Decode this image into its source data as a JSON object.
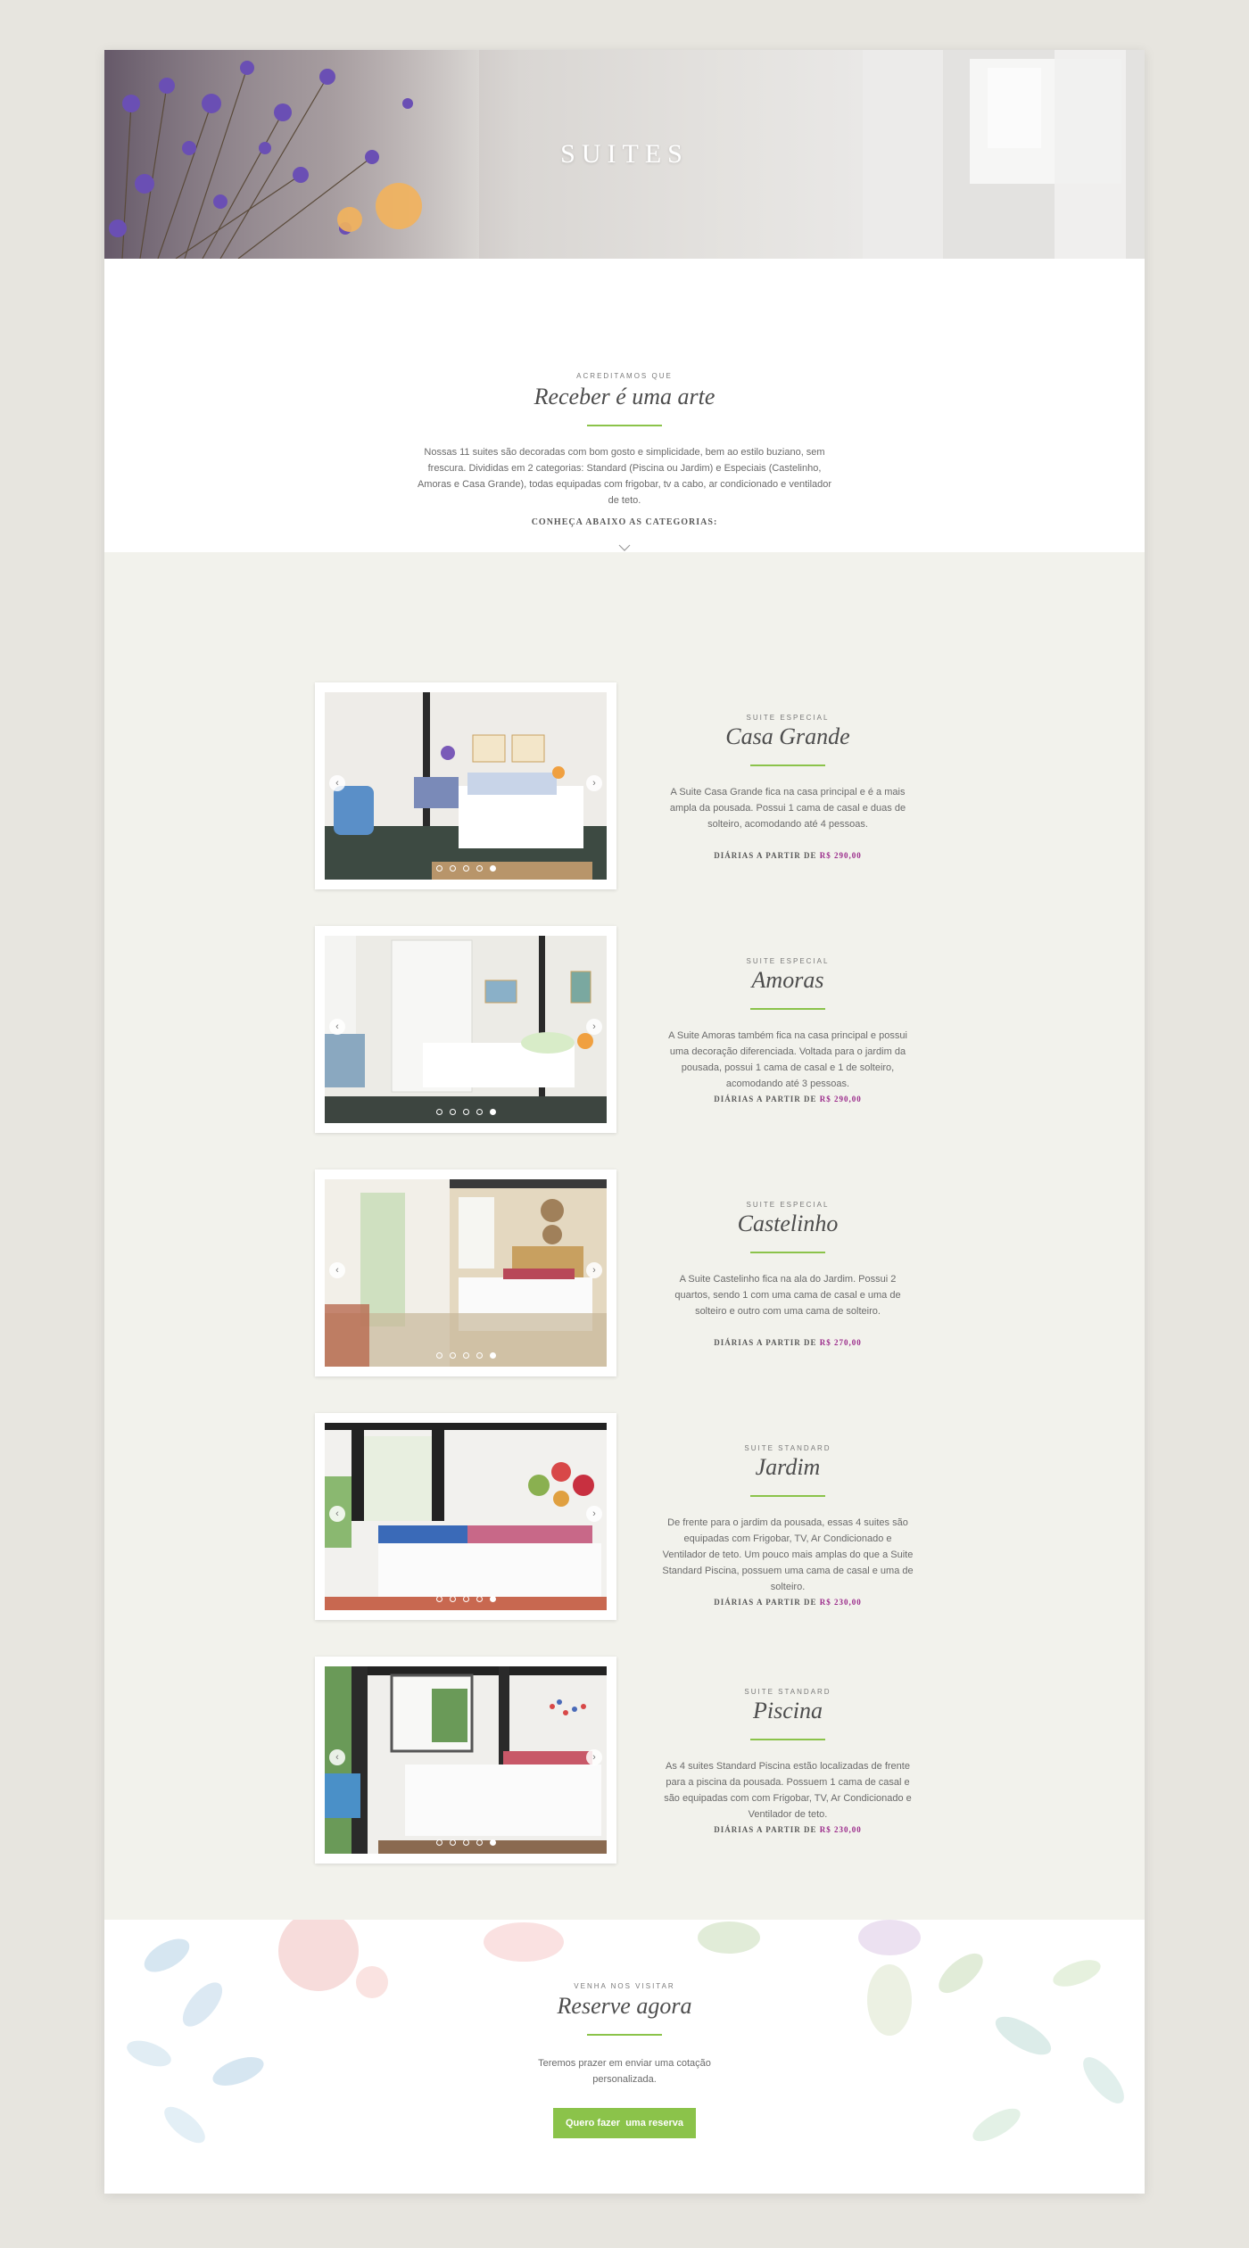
{
  "hero": {
    "title": "SUITES"
  },
  "intro": {
    "eyebrow": "ACREDITAMOS QUE",
    "title": "Receber é uma arte",
    "description": "Nossas 11 suites são decoradas com bom gosto e simplicidade, bem ao estilo buziano, sem frescura. Divididas em 2 categorias: Standard (Piscina ou Jardim) e Especiais (Castelinho, Amoras e Casa Grande), todas equipadas com frigobar, tv a cabo, ar condicionado e ventilador de teto.",
    "categories_label": "CONHEÇA ABAIXO AS CATEGORIAS:"
  },
  "price_prefix": "DIÁRIAS A PARTIR DE",
  "suites": [
    {
      "category": "SUITE ESPECIAL",
      "name": "Casa Grande",
      "description": "A Suite Casa Grande fica na casa principal e é a mais ampla da pousada. Possui 1 cama de casal e duas de solteiro, acomodando até 4 pessoas.",
      "price": "R$ 290,00"
    },
    {
      "category": "SUITE ESPECIAL",
      "name": "Amoras",
      "description": "A Suite Amoras também fica na casa principal e possui uma decoração diferenciada. Voltada para o jardim da pousada, possui 1 cama de casal e 1 de solteiro, acomodando até 3 pessoas.",
      "price": "R$ 290,00"
    },
    {
      "category": "SUITE ESPECIAL",
      "name": "Castelinho",
      "description": "A Suite Castelinho fica na ala do Jardim. Possui 2 quartos, sendo 1 com uma cama de casal e uma de solteiro e outro com uma cama de solteiro.",
      "price": "R$ 270,00"
    },
    {
      "category": "SUITE STANDARD",
      "name": "Jardim",
      "description": "De frente para o jardim da pousada, essas 4 suites são equipadas com Frigobar, TV, Ar Condicionado e Ventilador de teto. Um pouco mais amplas do que a Suite Standard Piscina, possuem uma cama de casal e uma de solteiro.",
      "price": "R$ 230,00"
    },
    {
      "category": "SUITE STANDARD",
      "name": "Piscina",
      "description": "As 4 suites Standard Piscina estão localizadas de frente para a piscina da pousada. Possuem 1 cama de casal e são equipadas com com Frigobar, TV, Ar Condicionado e Ventilador de teto.",
      "price": "R$ 230,00"
    }
  ],
  "carousel": {
    "prev_icon": "chevron-left-icon",
    "next_icon": "chevron-right-icon",
    "slide_count": 5
  },
  "reserve": {
    "eyebrow": "VENHA NOS VISITAR",
    "title": "Reserve agora",
    "text": "Teremos prazer em enviar uma cotação personalizada.",
    "button": "Quero fazer  uma reserva"
  },
  "colors": {
    "accent_green": "#8bc34a",
    "price_purple": "#9b2b8b",
    "section_bg": "#f2f2ec",
    "page_bg": "#e7e5df"
  }
}
